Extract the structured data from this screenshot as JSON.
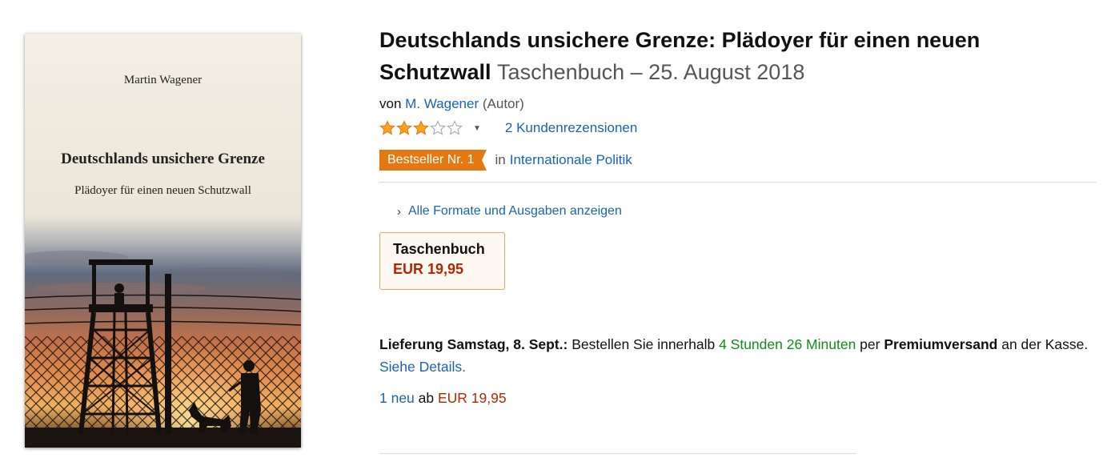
{
  "cover": {
    "author": "Martin Wagener",
    "title": "Deutschlands unsichere Grenze",
    "subtitle": "Plädoyer für einen neuen Schutzwall"
  },
  "product": {
    "title": "Deutschlands unsichere Grenze: Plädoyer für einen neuen Schutzwall",
    "binding_date": "Taschenbuch – 25. August 2018",
    "by_prefix": "von",
    "author": "M. Wagener",
    "author_role": "(Autor)"
  },
  "rating": {
    "stars": 3,
    "max": 5,
    "reviews_label": "2 Kundenrezensionen",
    "caret_icon": "caret-down-icon"
  },
  "bestseller": {
    "badge": "Bestseller Nr. 1",
    "in_label": "in",
    "category": "Internationale Politik"
  },
  "formats": {
    "link_label": "Alle Formate und Ausgaben anzeigen",
    "chevron_icon": "chevron-right-icon",
    "selected": {
      "name": "Taschenbuch",
      "price": "EUR 19,95"
    }
  },
  "delivery": {
    "heading": "Lieferung Samstag, 8. Sept.:",
    "text1": " Bestellen Sie innerhalb ",
    "countdown": "4 Stunden 26 Minuten",
    "text2": " per ",
    "method": "Premiumversand",
    "text3": " an der Kasse. ",
    "details_link": "Siehe Details."
  },
  "offers": {
    "count_link": "1 neu",
    "from": " ab ",
    "price": "EUR 19,95"
  },
  "colors": {
    "link": "#1a63b0",
    "price": "#b12704",
    "badge": "#e47911",
    "countdown": "#138a1b",
    "star": "#ffa41c"
  }
}
